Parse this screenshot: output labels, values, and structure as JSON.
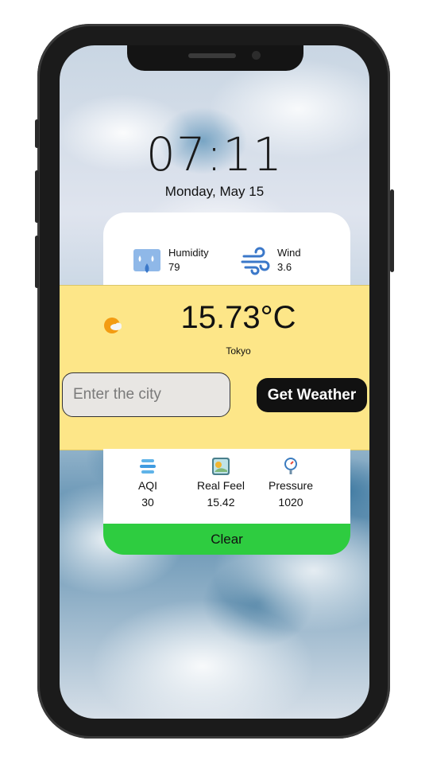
{
  "lockscreen": {
    "time": "07:11",
    "date": "Monday, May 15"
  },
  "weather_card": {
    "humidity": {
      "label": "Humidity",
      "value": "79",
      "icon": "humidity-icon"
    },
    "wind": {
      "label": "Wind",
      "value": "3.6",
      "icon": "wind-icon"
    },
    "temperature": "15.73°C",
    "city": "Tokyo",
    "condition_icon": "partly-cloudy-icon",
    "search": {
      "placeholder": "Enter the city",
      "button_label": "Get Weather"
    },
    "metrics": [
      {
        "label": "AQI",
        "value": "30",
        "icon": "aqi-icon"
      },
      {
        "label": "Real Feel",
        "value": "15.42",
        "icon": "real-feel-icon"
      },
      {
        "label": "Pressure",
        "value": "1020",
        "icon": "pressure-icon"
      }
    ],
    "condition_label": "Clear"
  },
  "colors": {
    "panel_yellow": "#fde688",
    "clear_green": "#2ecc40",
    "button_black": "#111111"
  }
}
